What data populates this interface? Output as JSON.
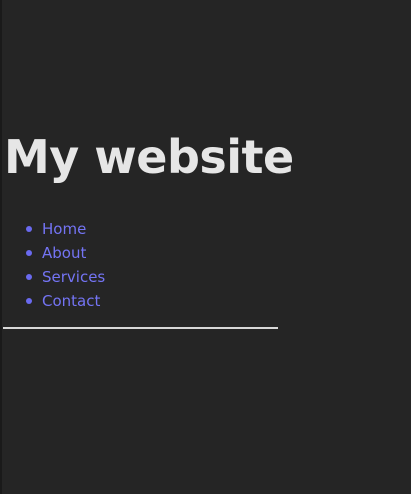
{
  "header": {
    "title": "My website"
  },
  "nav": {
    "items": [
      {
        "label": "Home"
      },
      {
        "label": "About"
      },
      {
        "label": "Services"
      },
      {
        "label": "Contact"
      }
    ]
  },
  "colors": {
    "background": "#252525",
    "title": "#e6e6e6",
    "link": "#7474f4",
    "divider": "#d8d8d8"
  }
}
